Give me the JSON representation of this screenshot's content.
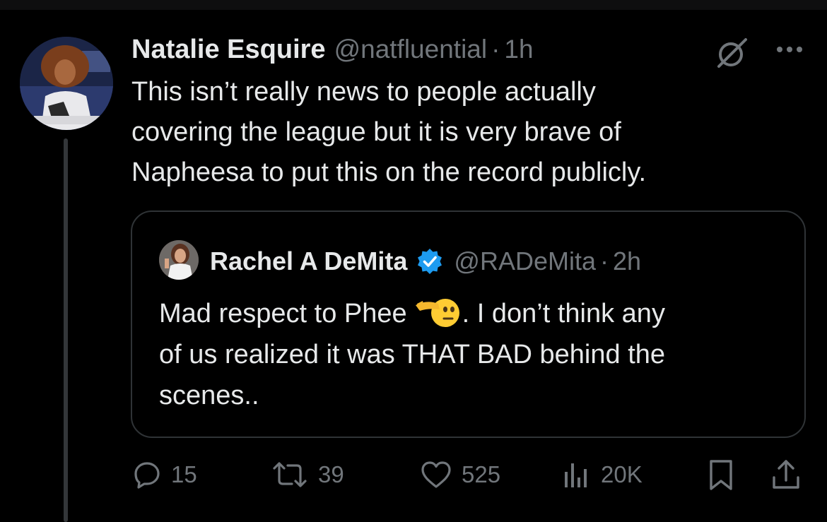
{
  "tweet": {
    "author": {
      "display_name": "Natalie Esquire",
      "handle": "@natfluential",
      "separator": "·",
      "time": "1h"
    },
    "text_lines": [
      "This isn’t really news to people actually",
      "covering the league but it is very brave of",
      "Napheesa to put this on the record publicly."
    ],
    "top_icons": [
      "grok-icon",
      "more-icon"
    ]
  },
  "quote": {
    "author": {
      "display_name": "Rachel A DeMita",
      "verified": true,
      "handle": "@RADeMita",
      "separator": "·",
      "time": "2h"
    },
    "text_lines": {
      "line1_before_emoji": "Mad respect to Phee",
      "line1_after_emoji": ". I don’t think any",
      "line2": "of us realized it was THAT BAD behind the",
      "line3": "scenes.."
    },
    "emoji": "saluting-face-emoji"
  },
  "actions": {
    "replies": "15",
    "reposts": "39",
    "likes": "525",
    "views": "20K",
    "icons": [
      "reply-icon",
      "repost-icon",
      "like-icon",
      "views-icon",
      "bookmark-icon",
      "share-icon"
    ]
  },
  "colors": {
    "background": "#000000",
    "primary_text": "#e7e9ea",
    "secondary_text": "#71767b",
    "border": "#2f3336",
    "verified_blue": "#1d9bf0"
  }
}
